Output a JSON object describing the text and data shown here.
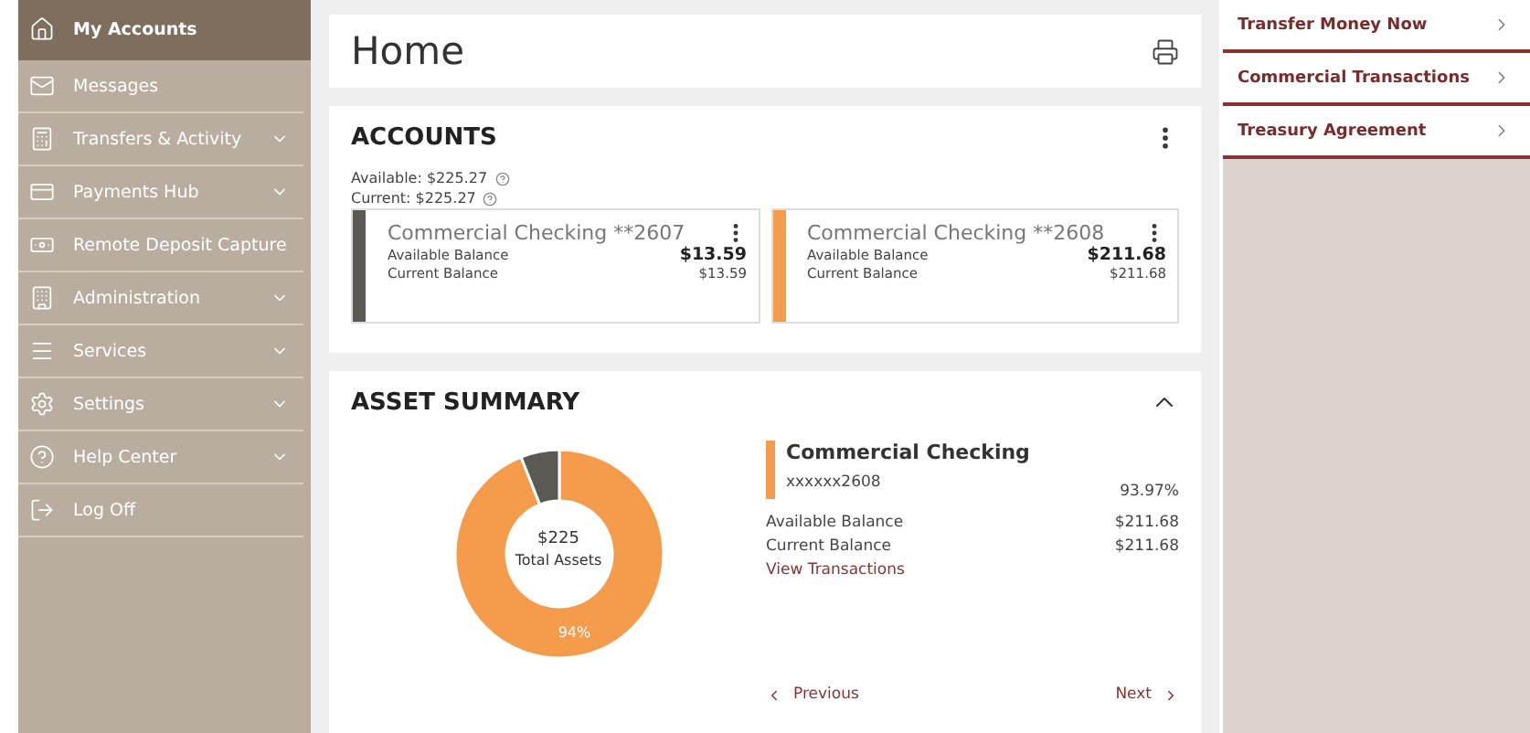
{
  "sidebar": {
    "items": [
      {
        "label": "My Accounts",
        "selected": true,
        "expandable": false
      },
      {
        "label": "Messages",
        "selected": false,
        "expandable": false
      },
      {
        "label": "Transfers & Activity",
        "selected": false,
        "expandable": true
      },
      {
        "label": "Payments Hub",
        "selected": false,
        "expandable": true
      },
      {
        "label": "Remote Deposit Capture",
        "selected": false,
        "expandable": false
      },
      {
        "label": "Administration",
        "selected": false,
        "expandable": true
      },
      {
        "label": "Services",
        "selected": false,
        "expandable": true
      },
      {
        "label": "Settings",
        "selected": false,
        "expandable": true
      },
      {
        "label": "Help Center",
        "selected": false,
        "expandable": true
      },
      {
        "label": "Log Off",
        "selected": false,
        "expandable": false
      }
    ]
  },
  "page_title": "Home",
  "accounts": {
    "title": "ACCOUNTS",
    "available": "Available: $225.27",
    "current": "Current: $225.27",
    "cards": [
      {
        "name": "Commercial Checking **2607",
        "color": "#5a5953",
        "available_label": "Available Balance",
        "available": "$13.59",
        "current_label": "Current Balance",
        "current": "$13.59"
      },
      {
        "name": "Commercial Checking **2608",
        "color": "#f59c4c",
        "available_label": "Available Balance",
        "available": "$211.68",
        "current_label": "Current Balance",
        "current": "$211.68"
      }
    ]
  },
  "asset_summary": {
    "title": "ASSET SUMMARY",
    "expanded": true,
    "total": "$225",
    "total_label": "Total Assets",
    "chart_data": {
      "type": "donut",
      "values": [
        94,
        6
      ],
      "colors": [
        "#f59c4c",
        "#5a5953"
      ],
      "value_labels": [
        "94%",
        null
      ]
    },
    "detail": {
      "name": "Commercial Checking",
      "number": "xxxxxx2608",
      "color": "#f59c4c",
      "share": "93.97%",
      "available_label": "Available Balance",
      "available": "$211.68",
      "current_label": "Current Balance",
      "current": "$211.68",
      "link": "View Transactions"
    },
    "previous": "Previous",
    "next": "Next"
  },
  "quick_links": [
    "Transfer Money Now",
    "Commercial Transactions",
    "Treasury Agreement"
  ]
}
